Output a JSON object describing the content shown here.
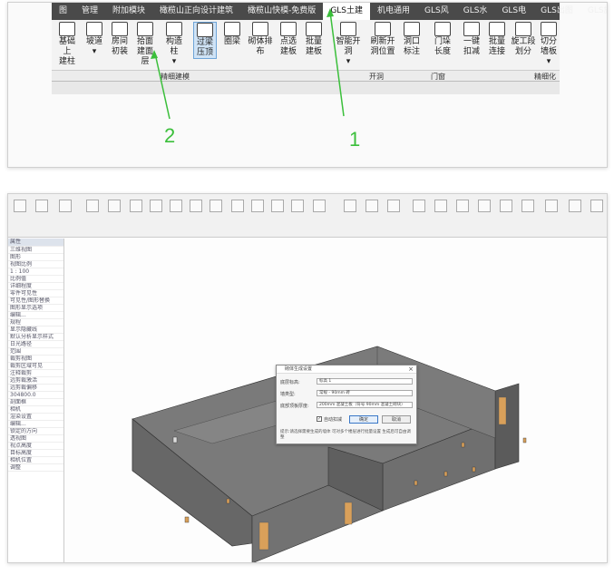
{
  "top_panel": {
    "tabs": [
      "图",
      "管理",
      "附加模块",
      "橄榄山正向设计建筑",
      "橄榄山快模-免费版",
      "GLS土建",
      "机电通用",
      "GLS风",
      "GLS水",
      "GLS电",
      "GLS出图",
      "GLS族"
    ],
    "active_tab": "GLS土建",
    "buttons": [
      {
        "label1": "基础上",
        "label2": "建柱"
      },
      {
        "label1": "坡道",
        "label2": "▾"
      },
      {
        "label1": "房间",
        "label2": "初装"
      },
      {
        "label1": "拾面",
        "label2": "建面层"
      },
      {
        "label1": "构造柱",
        "label2": "▾"
      },
      {
        "label1": "过梁",
        "label2": "压顶"
      },
      {
        "label1": "圈梁",
        "label2": ""
      },
      {
        "label1": "砌体排布",
        "label2": ""
      },
      {
        "label1": "点选",
        "label2": "建板"
      },
      {
        "label1": "批量",
        "label2": "建板"
      },
      {
        "label1": "智能开洞",
        "label2": "▾"
      },
      {
        "label1": "刷新开",
        "label2": "洞位置"
      },
      {
        "label1": "洞口",
        "label2": "标注"
      },
      {
        "label1": "门垛",
        "label2": "长度"
      },
      {
        "label1": "一键",
        "label2": "扣减"
      },
      {
        "label1": "批量",
        "label2": "连接"
      },
      {
        "label1": "旋工段",
        "label2": "划分"
      },
      {
        "label1": "切分墙板",
        "label2": "▾"
      }
    ],
    "groups": [
      "精细建模",
      "开洞",
      "门窗",
      "精细化"
    ],
    "annotation_1": "1",
    "annotation_2": "2"
  },
  "bottom_panel": {
    "left_pane_rows": [
      "属性",
      "三维视图",
      "图形",
      "视图比例",
      "1 : 100",
      "比例值",
      "详细程度",
      "零件可见性",
      "可见性/图形替换",
      "图形显示选项",
      "编辑...",
      "规程",
      "显示隐藏线",
      "默认分析显示样式",
      "日光路径",
      "范围",
      "裁剪视图",
      "裁剪区域可见",
      "注释裁剪",
      "远剪裁激活",
      "远剪裁偏移",
      "304800.0",
      "剖面框",
      "相机",
      "渲染设置",
      "编辑...",
      "锁定的方向",
      "透视图",
      "视点高度",
      "目标高度",
      "相机位置",
      "调整"
    ],
    "dialog": {
      "title": "砌体生成设置",
      "close": "×",
      "row1_label": "底层标高:",
      "row1_value": "标高 1",
      "row2_label": "墙类型:",
      "row2_value": "常规 - 90mm 砖",
      "row3_label": "底部顶板厚度:",
      "row3_value": "200mm 混凝土板（符号 90mm 混凝土砌块）",
      "checkbox_label": "自动扣减",
      "ok_label": "确定",
      "cancel_label": "取消",
      "note": "提示:请选择需要生成的墙体 可对多个楼层进行批量设置 生成后可自由调整"
    }
  },
  "colors": {
    "tab_bar": "#4a4a4a",
    "annotation": "#3bbf3b",
    "wall": "#6b6b6b",
    "wall_top": "#7d7d7d",
    "door": "#d9a05a"
  }
}
